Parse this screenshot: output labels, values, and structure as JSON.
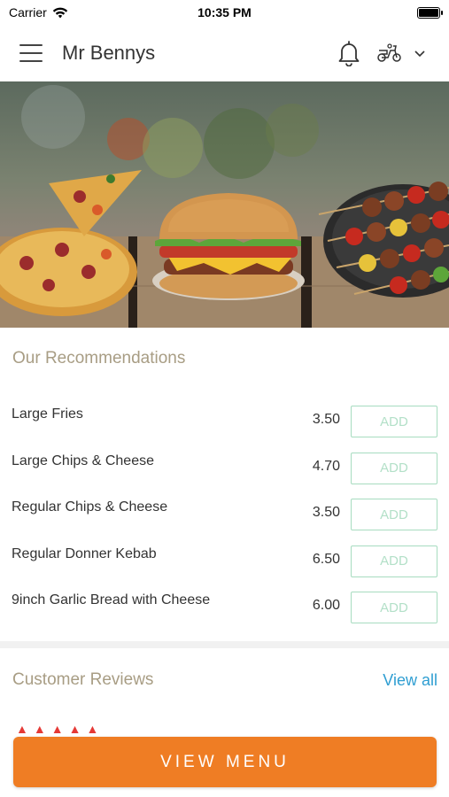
{
  "status_bar": {
    "carrier": "Carrier",
    "time": "10:35 PM"
  },
  "header": {
    "title": "Mr Bennys",
    "icons": [
      "menu-icon",
      "bell-icon",
      "scooter-icon",
      "chevron-down-icon"
    ]
  },
  "recommendations": {
    "title": "Our Recommendations",
    "add_label": "ADD",
    "items": [
      {
        "name": "Large Fries",
        "price": "3.50"
      },
      {
        "name": "Large Chips & Cheese",
        "price": "4.70"
      },
      {
        "name": "Regular Chips & Cheese",
        "price": "3.50"
      },
      {
        "name": "Regular Donner Kebab",
        "price": "6.50"
      },
      {
        "name": "9inch Garlic Bread with Cheese",
        "price": "6.00"
      }
    ]
  },
  "reviews": {
    "title": "Customer Reviews",
    "view_all": "View all",
    "stars": 5
  },
  "cta": {
    "label": "VIEW MENU"
  },
  "colors": {
    "accent": "#ef7d24",
    "section_title": "#a89d84",
    "link": "#2f9ed2",
    "add_border": "#a7dcc0",
    "star": "#e53935"
  }
}
